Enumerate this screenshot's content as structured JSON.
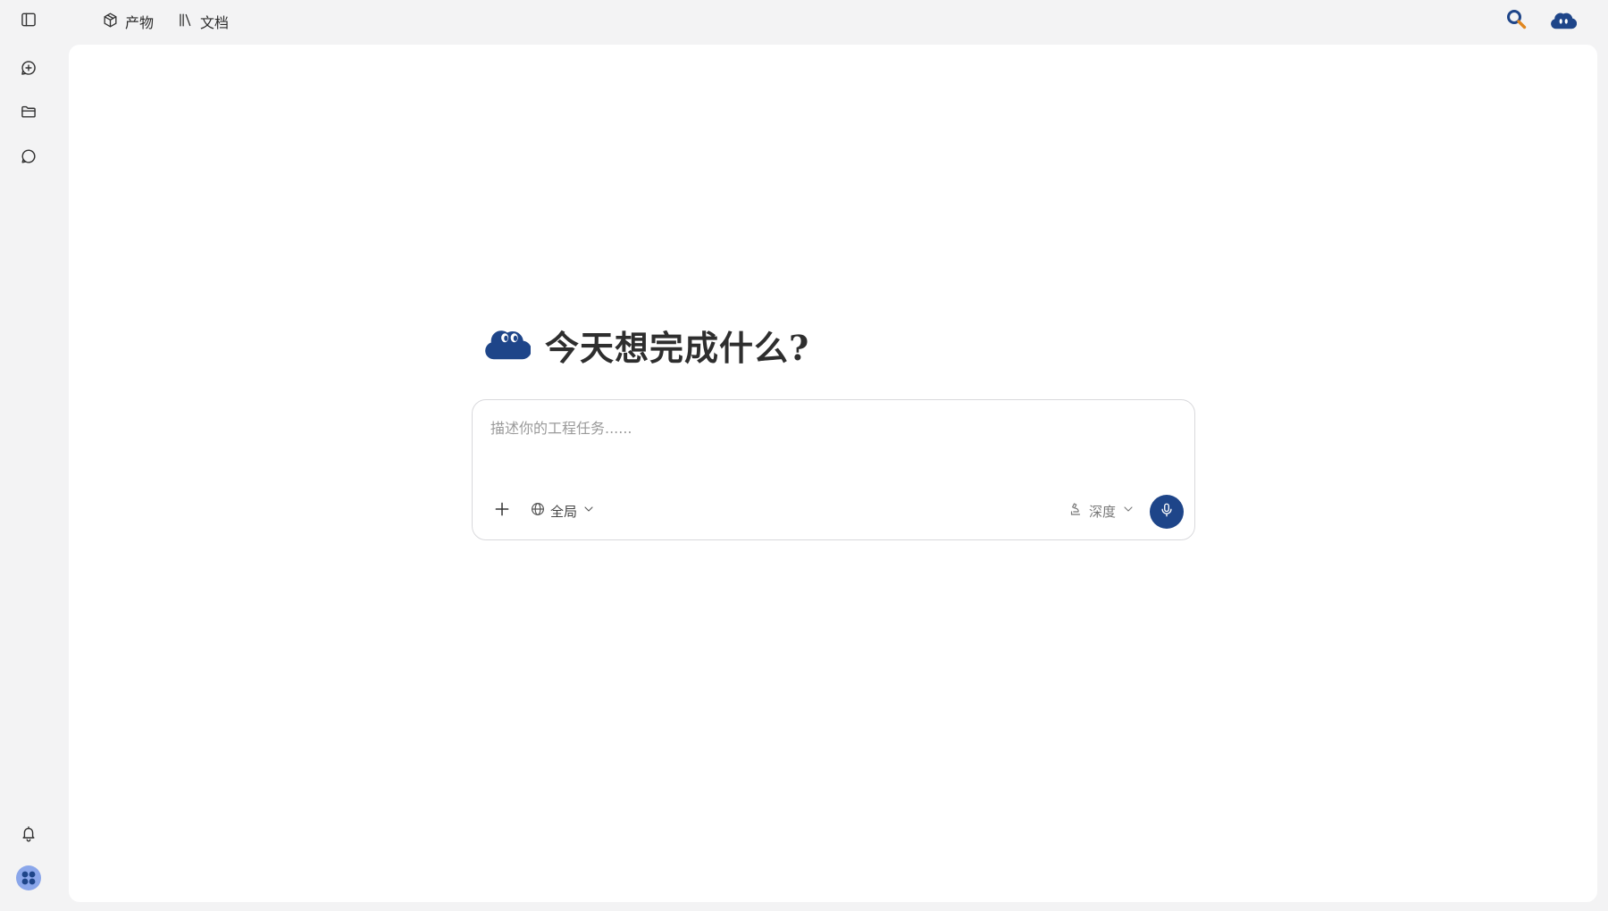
{
  "sidebar": {
    "items": [
      {
        "icon": "sidebar-toggle-icon"
      },
      {
        "icon": "new-chat-icon"
      },
      {
        "icon": "folder-icon"
      },
      {
        "icon": "chat-bubble-icon"
      }
    ],
    "bottom": [
      {
        "icon": "bell-icon"
      },
      {
        "icon": "apps-icon"
      }
    ]
  },
  "topnav": {
    "items": [
      {
        "label": "产物",
        "icon": "package-icon"
      },
      {
        "label": "文档",
        "icon": "library-icon"
      }
    ]
  },
  "topright": {
    "search_icon": "search-icon",
    "avatar_icon": "cloud-mascot-icon"
  },
  "hero": {
    "title": "今天想完成什么?"
  },
  "composer": {
    "placeholder": "描述你的工程任务......",
    "value": "",
    "scope_label": "全局",
    "depth_label": "深度"
  },
  "colors": {
    "brand": "#1e4589",
    "background": "#f3f3f4",
    "panel": "#ffffff",
    "accent_orange": "#e0861f",
    "apps_icon_bg": "#8aa6ea"
  }
}
